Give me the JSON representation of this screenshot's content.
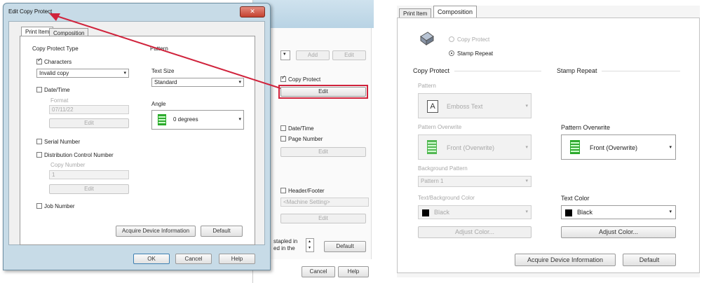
{
  "left_dialog": {
    "title": "Edit Copy Protect",
    "tabs": [
      "Print Item",
      "Composition"
    ],
    "copy_protect_type_label": "Copy Protect Type",
    "pattern_label": "Pattern",
    "characters_label": "Characters",
    "characters_value": "Invalid copy",
    "date_time_label": "Date/Time",
    "format_label": "Format",
    "date_value": "07/11/22",
    "edit_label": "Edit",
    "serial_number_label": "Serial Number",
    "dcn_label": "Distribution Control Number",
    "copy_number_label": "Copy Number",
    "copy_number_value": "1",
    "job_number_label": "Job Number",
    "text_size_label": "Text Size",
    "text_size_value": "Standard",
    "angle_label": "Angle",
    "angle_value": "0 degrees",
    "acquire_label": "Acquire Device Information",
    "default_label": "Default",
    "ok_label": "OK",
    "cancel_label": "Cancel",
    "help_label": "Help"
  },
  "behind_dialog": {
    "btn_1": "Add",
    "btn_2": "Edit",
    "copy_protect_label": "Copy Protect",
    "edit_label": "Edit",
    "date_time_label": "Date/Time",
    "page_number_label": "Page Number",
    "edit_label_2": "Edit",
    "header_footer_label": "Header/Footer",
    "header_footer_value": "<Machine Setting>",
    "edit_label_3": "Edit",
    "stapled_line1": "stapled in",
    "stapled_line2": "ed in the",
    "default_label": "Default",
    "cancel_label": "Cancel",
    "help_label": "Help"
  },
  "right_panel": {
    "tabs": [
      "Print Item",
      "Composition"
    ],
    "radio_copy_protect": "Copy Protect",
    "radio_stamp_repeat": "Stamp Repeat",
    "copy_protect_group": "Copy Protect",
    "stamp_repeat_group": "Stamp Repeat",
    "pattern_label": "Pattern",
    "pattern_value": "Emboss Text",
    "pattern_overwrite_label_disabled": "Pattern Overwrite",
    "pattern_overwrite_value_disabled": "Front (Overwrite)",
    "background_pattern_label": "Background Pattern",
    "background_pattern_value": "Pattern 1",
    "text_bg_color_label": "Text/Background Color",
    "text_bg_color_value": "Black",
    "adjust_color_disabled": "Adjust Color...",
    "pattern_overwrite_label": "Pattern Overwrite",
    "pattern_overwrite_value": "Front (Overwrite)",
    "text_color_label": "Text Color",
    "text_color_value": "Black",
    "adjust_color": "Adjust Color...",
    "acquire_label": "Acquire Device Information",
    "default_label": "Default"
  },
  "colors": {
    "title_bar": "#9fc3d9",
    "callout_red": "#d0233c",
    "disabled_text": "#a8a8a8"
  }
}
